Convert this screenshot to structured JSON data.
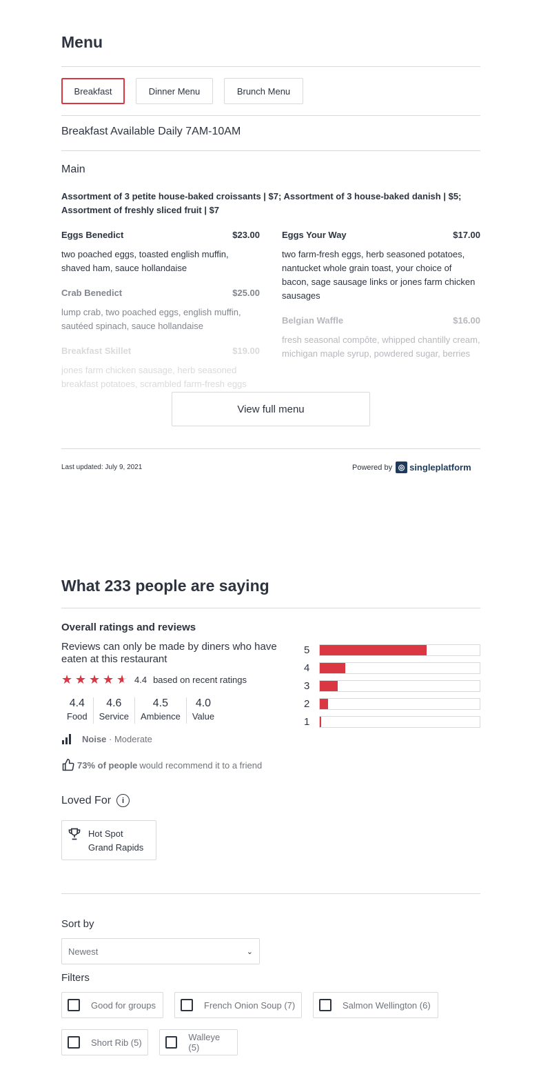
{
  "menu": {
    "title": "Menu",
    "tabs": [
      {
        "label": "Breakfast",
        "active": true
      },
      {
        "label": "Dinner Menu",
        "active": false
      },
      {
        "label": "Brunch Menu",
        "active": false
      }
    ],
    "availability": "Breakfast Available Daily 7AM-10AM",
    "section_title": "Main",
    "section_description": "Assortment of 3 petite house-baked croissants | $7; Assortment of 3 house-baked danish | $5; Assortment of freshly sliced fruit | $7",
    "left_items": [
      {
        "name": "Eggs Benedict",
        "price": "$23.00",
        "desc": "two poached eggs, toasted english muffin, shaved ham, sauce hollandaise"
      },
      {
        "name": "Crab Benedict",
        "price": "$25.00",
        "desc": "lump crab, two poached eggs, english muffin, sautéed spinach, sauce hollandaise"
      },
      {
        "name": "Breakfast Skillet",
        "price": "$19.00",
        "desc": "jones farm chicken sausage, herb seasoned breakfast potatoes, scrambled farm-fresh eggs"
      }
    ],
    "right_items": [
      {
        "name": "Eggs Your Way",
        "price": "$17.00",
        "desc": "two farm-fresh eggs, herb seasoned potatoes, nantucket whole grain toast, your choice of bacon, sage sausage links or jones farm chicken sausages"
      },
      {
        "name": "Belgian Waffle",
        "price": "$16.00",
        "desc": "fresh seasonal compôte, whipped chantilly cream, michigan maple syrup, powdered sugar, berries"
      }
    ],
    "view_full_label": "View full menu",
    "last_updated": "Last updated: July 9, 2021",
    "powered_by": "Powered by",
    "provider": "singleplatform"
  },
  "reviews": {
    "title": "What 233 people are saying",
    "overall_title": "Overall ratings and reviews",
    "note": "Reviews can only be made by diners who have eaten at this restaurant",
    "overall_rating": "4.4",
    "overall_stars": 4.4,
    "rating_basis": "based on recent ratings",
    "sub_ratings": [
      {
        "value": "4.4",
        "label": "Food"
      },
      {
        "value": "4.6",
        "label": "Service"
      },
      {
        "value": "4.5",
        "label": "Ambience"
      },
      {
        "value": "4.0",
        "label": "Value"
      }
    ],
    "distribution": [
      {
        "star": "5",
        "fraction": 0.67
      },
      {
        "star": "4",
        "fraction": 0.16
      },
      {
        "star": "3",
        "fraction": 0.11
      },
      {
        "star": "2",
        "fraction": 0.05
      },
      {
        "star": "1",
        "fraction": 0.01
      }
    ],
    "noise_label": "Noise",
    "noise_value": "· Moderate",
    "recommend_pct": "73% of people",
    "recommend_text": "would recommend it to a friend",
    "loved_for": "Loved For",
    "badge_title": "Hot Spot",
    "badge_sub": "Grand Rapids",
    "sort_label": "Sort by",
    "sort_value": "Newest",
    "filters_label": "Filters",
    "filters": [
      "Good for groups",
      "French Onion Soup (7)",
      "Salmon Wellington (6)",
      "Short Rib (5)",
      "Walleye (5)"
    ],
    "accent_color": "#da3743"
  }
}
